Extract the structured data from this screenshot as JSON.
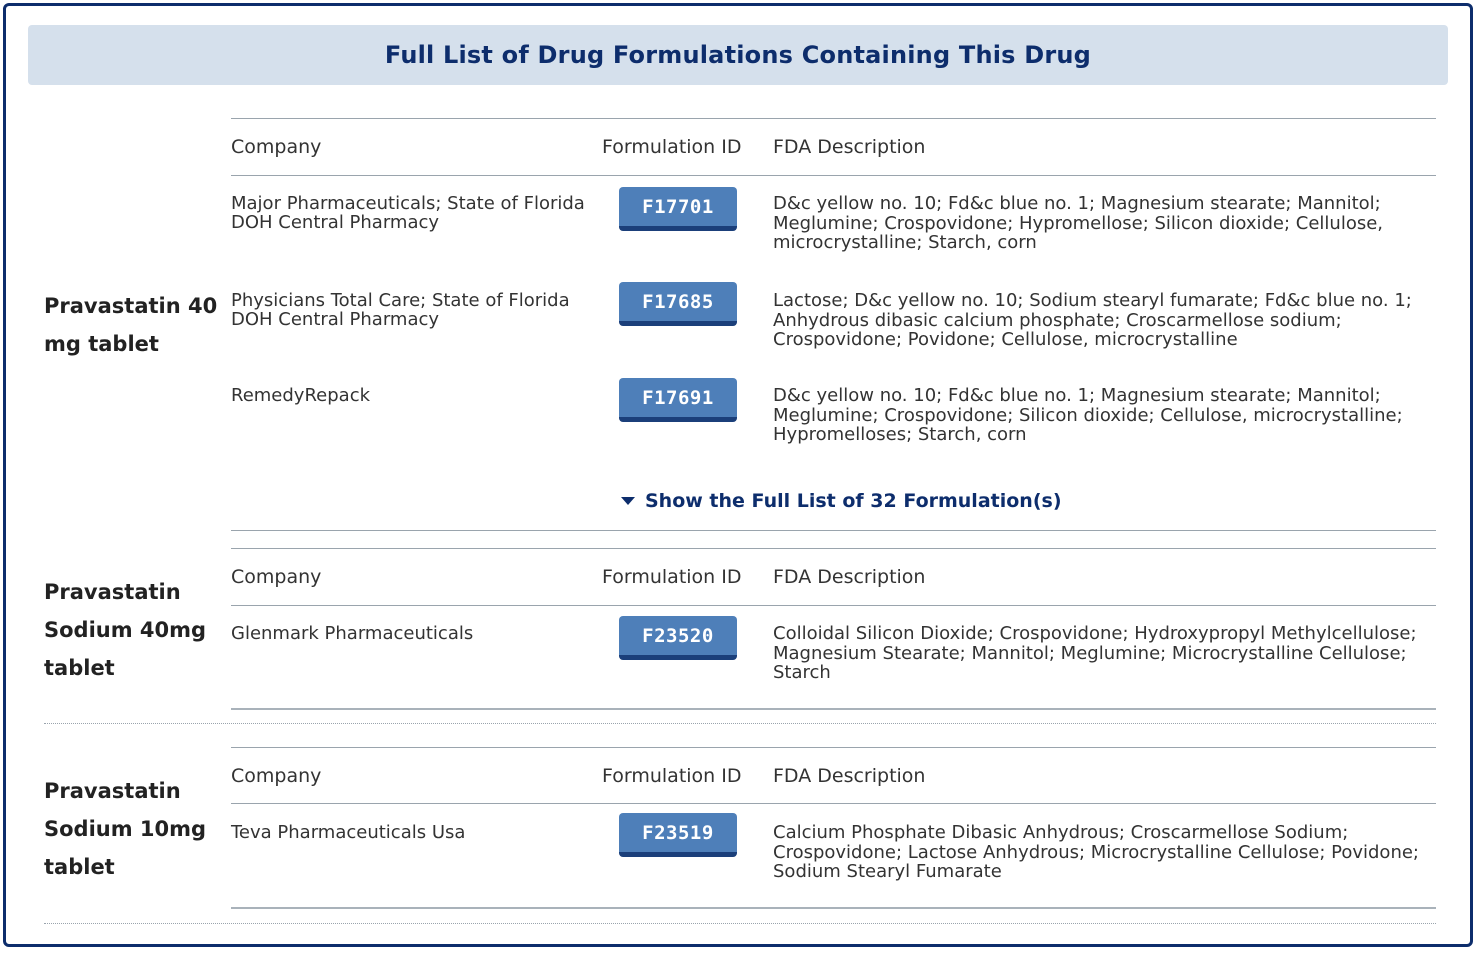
{
  "header": {
    "title": "Full List of Drug Formulations Containing This Drug"
  },
  "columns": {
    "company": "Company",
    "formulation_id": "Formulation ID",
    "fda_description": "FDA Description"
  },
  "groups": [
    {
      "drug_name": "Pravastatin 40 mg tablet",
      "rows": [
        {
          "company": "Major Pharmaceuticals; State of Florida DOH Central Pharmacy",
          "formulation_id": "F17701",
          "description": "D&c yellow no. 10; Fd&c blue no. 1; Magnesium stearate; Mannitol; Meglumine; Crospovidone; Hypromellose; Silicon dioxide; Cellulose, microcrystalline; Starch, corn"
        },
        {
          "company": "Physicians Total Care; State of Florida DOH Central Pharmacy",
          "formulation_id": "F17685",
          "description": "Lactose; D&c yellow no. 10; Sodium stearyl fumarate; Fd&c blue no. 1; Anhydrous dibasic calcium phosphate; Croscarmellose sodium; Crospovidone; Povidone; Cellulose, microcrystalline"
        },
        {
          "company": "RemedyRepack",
          "formulation_id": "F17691",
          "description": "D&c yellow no. 10; Fd&c blue no. 1; Magnesium stearate; Mannitol; Meglumine; Crospovidone; Silicon dioxide; Cellulose, microcrystalline; Hypromelloses; Starch, corn"
        }
      ],
      "show_more": "Show the Full List of 32 Formulation(s)"
    },
    {
      "drug_name": "Pravastatin Sodium 40mg tablet",
      "rows": [
        {
          "company": "Glenmark Pharmaceuticals",
          "formulation_id": "F23520",
          "description": "Colloidal Silicon Dioxide; Crospovidone; Hydroxypropyl Methylcellulose; Magnesium Stearate; Mannitol; Meglumine; Microcrystalline Cellulose; Starch"
        }
      ]
    },
    {
      "drug_name": "Pravastatin Sodium 10mg tablet",
      "rows": [
        {
          "company": "Teva Pharmaceuticals Usa",
          "formulation_id": "F23519",
          "description": "Calcium Phosphate Dibasic Anhydrous; Croscarmellose Sodium; Crospovidone; Lactose Anhydrous; Microcrystalline Cellulose; Povidone; Sodium Stearyl Fumarate"
        }
      ]
    }
  ],
  "colors": {
    "accent": "#0d2d6c",
    "header_bg": "#d5e0ec",
    "button": "#4e7fb9",
    "button_shadow": "#1b3f7a"
  }
}
